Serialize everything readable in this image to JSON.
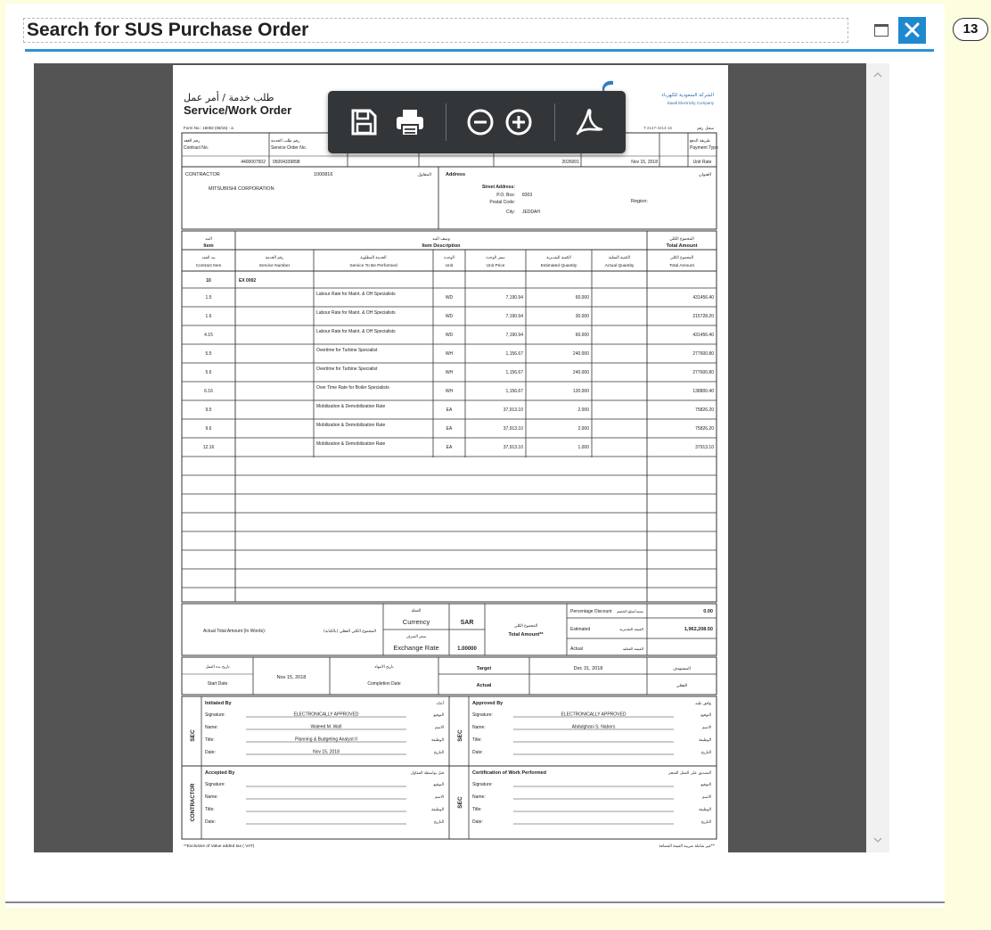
{
  "window": {
    "title": "Search for SUS Purchase Order",
    "callout_number": "13"
  },
  "pdf_toolbar": {
    "buttons": [
      "save-icon",
      "print-icon",
      "zoom-out-icon",
      "zoom-in-icon",
      "acrobat-icon"
    ]
  },
  "document": {
    "header": {
      "title_ar": "طلب خدمة / أمر عمل",
      "title_en": "Service/Work Order",
      "form_no": "Form No.: 15002 (08/15) - a",
      "company_ar": "الشركة السعودية للكهرباء",
      "company_en": "Saudi Electricity Company",
      "ref_no": "T-2147-4214-15",
      "ref_ar": "سجل رقم"
    },
    "top_fields": {
      "contract_no_label_ar": "رقم العقد",
      "contract_no_label": "Contract No.",
      "contract_no": "4400007502",
      "service_order_label_ar": "رقم طلب الخدمة",
      "service_order_label": "Service Order No.",
      "service_order_no": "05004339898",
      "ref_value": "2026001",
      "date": "Nov 15, 2018",
      "payment_label_ar": "طريقة الدفع",
      "payment_label": "Payment Type",
      "payment_type": "Unit Rate"
    },
    "contractor": {
      "label": "CONTRACTOR",
      "code": "1000816",
      "label_ar": "المقاول",
      "name": "MITSUBISHI CORPORATION",
      "address_label": "Address",
      "address_label_ar": "العنوان",
      "street_label": "Street Address:",
      "po_box_label": "P.O. Box:",
      "po_box": "8303",
      "postal_label": "Postal Code:",
      "city_label": "City:",
      "city": "JEDDAH",
      "region_label": "Region:"
    },
    "item_header": {
      "item_ar": "البند",
      "item": "Item",
      "desc_ar": "وصف البند",
      "desc": "Item Description",
      "total_ar": "المجموع الكلي",
      "total": "Total Amount"
    },
    "columns": [
      {
        "ar": "بند العقد",
        "en": "Contract Item"
      },
      {
        "ar": "رقم الخدمة",
        "en": "Service Number"
      },
      {
        "ar": "الخدمة المطلوبة",
        "en": "Service To Be Performed"
      },
      {
        "ar": "الوحدة",
        "en": "Unit"
      },
      {
        "ar": "سعر الوحدة",
        "en": "Unit Price"
      },
      {
        "ar": "الكمية التقديرية",
        "en": "Estimated Quantity"
      },
      {
        "ar": "الكمية الفعلية",
        "en": "Actual Quantity"
      },
      {
        "ar": "المجموع الكلي",
        "en": "Total Amount"
      }
    ],
    "group_row": {
      "item": "10",
      "code": "EX 0002"
    },
    "rows": [
      {
        "item": "1.5",
        "service": "Labour  Rate for Maint. & OH Specialists",
        "unit": "WD",
        "price": "7,190.94",
        "qty": "60.000",
        "total": "431456.40"
      },
      {
        "item": "1.6",
        "service": "Labour  Rate for Maint. & OH Specialists",
        "unit": "WD",
        "price": "7,190.94",
        "qty": "30.000",
        "total": "215728.20"
      },
      {
        "item": "4.15",
        "service": "Labour  Rate for Maint. & OH Specialists",
        "unit": "WD",
        "price": "7,190.94",
        "qty": "60.000",
        "total": "431456.40"
      },
      {
        "item": "5.5",
        "service": "Overtime for Turbine Specialist",
        "unit": "WH",
        "price": "1,156.67",
        "qty": "240.000",
        "total": "277600.80"
      },
      {
        "item": "5.6",
        "service": "Overtime for Turbine Specialist",
        "unit": "WH",
        "price": "1,156.67",
        "qty": "240.000",
        "total": "277600.80"
      },
      {
        "item": "6.16",
        "service": "Over Time  Rate for Boiler Specialists",
        "unit": "WH",
        "price": "1,156.67",
        "qty": "120.000",
        "total": "138800.40"
      },
      {
        "item": "9.5",
        "service": "Mobilization & Demobilization Rate",
        "unit": "EA",
        "price": "37,913.10",
        "qty": "2.000",
        "total": "75826.20"
      },
      {
        "item": "9.6",
        "service": "Mobilization & Demobilization Rate",
        "unit": "EA",
        "price": "37,913.10",
        "qty": "2.000",
        "total": "75826.20"
      },
      {
        "item": "12.16",
        "service": "Mobilization & Demobilization Rate",
        "unit": "EA",
        "price": "37,913.10",
        "qty": "1.000",
        "total": "37913.10"
      }
    ],
    "totals": {
      "words_label": "Actual Total Amount (In Words):",
      "words_label_ar": "المجموع الكلي الفعلي (بالكتابة)",
      "currency_label_ar": "العملة",
      "currency_label": "Currency",
      "currency": "SAR",
      "exchange_label_ar": "سعر الصرف",
      "exchange_label": "Exchange Rate",
      "exchange_rate": "1.00000",
      "total_label_ar": "المجموع الكلي",
      "total_label": "Total Amount**",
      "discount_label": "Percentage Discount",
      "discount_label_ar": "نسبة/مبلغ الخصم",
      "discount": "0.00",
      "estimated_label": "Estimated",
      "estimated_label_ar": "القيمة التقديرية",
      "estimated": "1,962,208.50",
      "actual_label": "Actual",
      "actual_label_ar": "القيمة الفعلية"
    },
    "dates": {
      "start_label_ar": "تاريخ بدء العمل",
      "start_label": "Start Date",
      "start": "Nov 15, 2018",
      "completion_label_ar": "تاريخ الانتهاء",
      "completion_label": "Completion Date",
      "target_label": "Target",
      "target": "Dec 31, 2018",
      "target_ar": "المستهدف",
      "actual_label": "Actual",
      "actual_ar": "الفعلي"
    },
    "signatures": {
      "sec": "SEC",
      "contractor_side": "CONTRACTOR",
      "initiated_by": "Initiated By",
      "initiated_ar": "أعدّه",
      "approved_by": "Approved By",
      "approved_ar": "وافق عليه",
      "accepted_by": "Accepted By",
      "accepted_ar": "قبل بواسطة المقاول",
      "certification": "Certification of Work Performed",
      "certification_ar": "التصديق على العمل المنجز",
      "signature_label": "Signature:",
      "name_label": "Name:",
      "title_label": "Title:",
      "date_label": "Date:",
      "signature_ar": "التوقيع",
      "name_ar": "الاسم",
      "title_ar": "الوظيفة",
      "date_ar": "التاريخ",
      "initiated_signature": "ELECTRONICALLY APPROVED",
      "initiated_name": "Waleed M. Wafi",
      "initiated_title": "Planning & Budgeting Analyst II",
      "initiated_date": "Nov 15, 2018",
      "approved_signature": "ELECTRONICALLY APPROVED",
      "approved_name": "Abdulghani S. Nabors"
    },
    "footer": {
      "note": "**Exclusive of Value added tax ( VAT)",
      "note_ar": "غير شاملة ضريبة القيمة المضافة**"
    }
  }
}
